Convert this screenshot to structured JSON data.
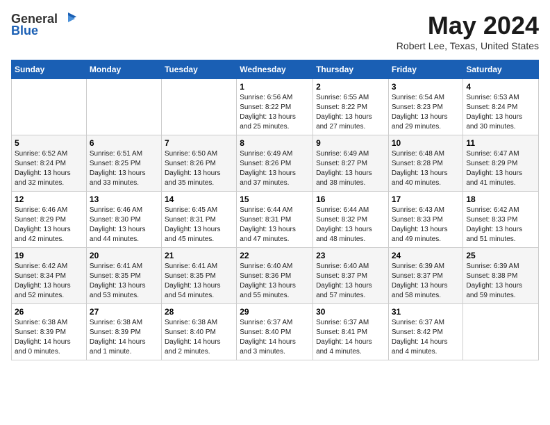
{
  "header": {
    "logo_general": "General",
    "logo_blue": "Blue",
    "month_year": "May 2024",
    "location": "Robert Lee, Texas, United States"
  },
  "days_of_week": [
    "Sunday",
    "Monday",
    "Tuesday",
    "Wednesday",
    "Thursday",
    "Friday",
    "Saturday"
  ],
  "weeks": [
    [
      {
        "day": "",
        "info": ""
      },
      {
        "day": "",
        "info": ""
      },
      {
        "day": "",
        "info": ""
      },
      {
        "day": "1",
        "info": "Sunrise: 6:56 AM\nSunset: 8:22 PM\nDaylight: 13 hours\nand 25 minutes."
      },
      {
        "day": "2",
        "info": "Sunrise: 6:55 AM\nSunset: 8:22 PM\nDaylight: 13 hours\nand 27 minutes."
      },
      {
        "day": "3",
        "info": "Sunrise: 6:54 AM\nSunset: 8:23 PM\nDaylight: 13 hours\nand 29 minutes."
      },
      {
        "day": "4",
        "info": "Sunrise: 6:53 AM\nSunset: 8:24 PM\nDaylight: 13 hours\nand 30 minutes."
      }
    ],
    [
      {
        "day": "5",
        "info": "Sunrise: 6:52 AM\nSunset: 8:24 PM\nDaylight: 13 hours\nand 32 minutes."
      },
      {
        "day": "6",
        "info": "Sunrise: 6:51 AM\nSunset: 8:25 PM\nDaylight: 13 hours\nand 33 minutes."
      },
      {
        "day": "7",
        "info": "Sunrise: 6:50 AM\nSunset: 8:26 PM\nDaylight: 13 hours\nand 35 minutes."
      },
      {
        "day": "8",
        "info": "Sunrise: 6:49 AM\nSunset: 8:26 PM\nDaylight: 13 hours\nand 37 minutes."
      },
      {
        "day": "9",
        "info": "Sunrise: 6:49 AM\nSunset: 8:27 PM\nDaylight: 13 hours\nand 38 minutes."
      },
      {
        "day": "10",
        "info": "Sunrise: 6:48 AM\nSunset: 8:28 PM\nDaylight: 13 hours\nand 40 minutes."
      },
      {
        "day": "11",
        "info": "Sunrise: 6:47 AM\nSunset: 8:29 PM\nDaylight: 13 hours\nand 41 minutes."
      }
    ],
    [
      {
        "day": "12",
        "info": "Sunrise: 6:46 AM\nSunset: 8:29 PM\nDaylight: 13 hours\nand 42 minutes."
      },
      {
        "day": "13",
        "info": "Sunrise: 6:46 AM\nSunset: 8:30 PM\nDaylight: 13 hours\nand 44 minutes."
      },
      {
        "day": "14",
        "info": "Sunrise: 6:45 AM\nSunset: 8:31 PM\nDaylight: 13 hours\nand 45 minutes."
      },
      {
        "day": "15",
        "info": "Sunrise: 6:44 AM\nSunset: 8:31 PM\nDaylight: 13 hours\nand 47 minutes."
      },
      {
        "day": "16",
        "info": "Sunrise: 6:44 AM\nSunset: 8:32 PM\nDaylight: 13 hours\nand 48 minutes."
      },
      {
        "day": "17",
        "info": "Sunrise: 6:43 AM\nSunset: 8:33 PM\nDaylight: 13 hours\nand 49 minutes."
      },
      {
        "day": "18",
        "info": "Sunrise: 6:42 AM\nSunset: 8:33 PM\nDaylight: 13 hours\nand 51 minutes."
      }
    ],
    [
      {
        "day": "19",
        "info": "Sunrise: 6:42 AM\nSunset: 8:34 PM\nDaylight: 13 hours\nand 52 minutes."
      },
      {
        "day": "20",
        "info": "Sunrise: 6:41 AM\nSunset: 8:35 PM\nDaylight: 13 hours\nand 53 minutes."
      },
      {
        "day": "21",
        "info": "Sunrise: 6:41 AM\nSunset: 8:35 PM\nDaylight: 13 hours\nand 54 minutes."
      },
      {
        "day": "22",
        "info": "Sunrise: 6:40 AM\nSunset: 8:36 PM\nDaylight: 13 hours\nand 55 minutes."
      },
      {
        "day": "23",
        "info": "Sunrise: 6:40 AM\nSunset: 8:37 PM\nDaylight: 13 hours\nand 57 minutes."
      },
      {
        "day": "24",
        "info": "Sunrise: 6:39 AM\nSunset: 8:37 PM\nDaylight: 13 hours\nand 58 minutes."
      },
      {
        "day": "25",
        "info": "Sunrise: 6:39 AM\nSunset: 8:38 PM\nDaylight: 13 hours\nand 59 minutes."
      }
    ],
    [
      {
        "day": "26",
        "info": "Sunrise: 6:38 AM\nSunset: 8:39 PM\nDaylight: 14 hours\nand 0 minutes."
      },
      {
        "day": "27",
        "info": "Sunrise: 6:38 AM\nSunset: 8:39 PM\nDaylight: 14 hours\nand 1 minute."
      },
      {
        "day": "28",
        "info": "Sunrise: 6:38 AM\nSunset: 8:40 PM\nDaylight: 14 hours\nand 2 minutes."
      },
      {
        "day": "29",
        "info": "Sunrise: 6:37 AM\nSunset: 8:40 PM\nDaylight: 14 hours\nand 3 minutes."
      },
      {
        "day": "30",
        "info": "Sunrise: 6:37 AM\nSunset: 8:41 PM\nDaylight: 14 hours\nand 4 minutes."
      },
      {
        "day": "31",
        "info": "Sunrise: 6:37 AM\nSunset: 8:42 PM\nDaylight: 14 hours\nand 4 minutes."
      },
      {
        "day": "",
        "info": ""
      }
    ]
  ]
}
